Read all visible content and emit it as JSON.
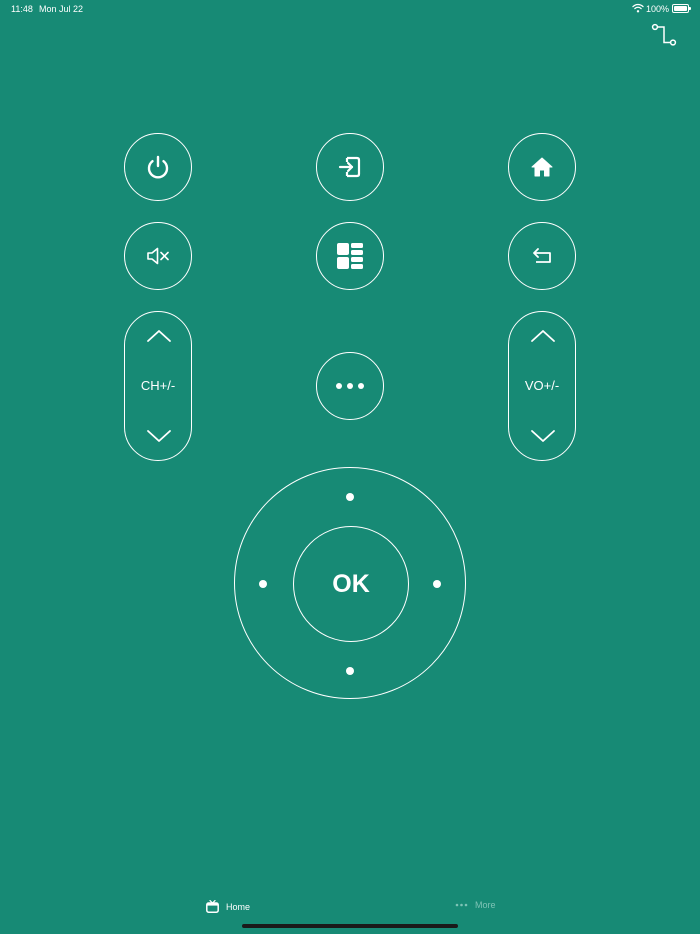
{
  "status_bar": {
    "time": "11:48",
    "date": "Mon Jul 22",
    "battery": "100%"
  },
  "remote": {
    "channel_label": "CH+/-",
    "volume_label": "VO+/-",
    "ok_label": "OK"
  },
  "tab_bar": {
    "home_label": "Home",
    "more_label": "More"
  },
  "icons": {
    "connect": "connection-route-icon",
    "power": "power-icon",
    "input": "input-source-icon",
    "home": "home-icon",
    "mute": "mute-icon",
    "menu": "menu-grid-icon",
    "back": "back-icon",
    "more": "more-dots-icon",
    "tab_home": "tv-icon",
    "tab_more": "ellipsis-icon"
  },
  "colors": {
    "background": "#178a75",
    "foreground": "#ffffff",
    "tab_inactive": "#7ec3b6"
  }
}
